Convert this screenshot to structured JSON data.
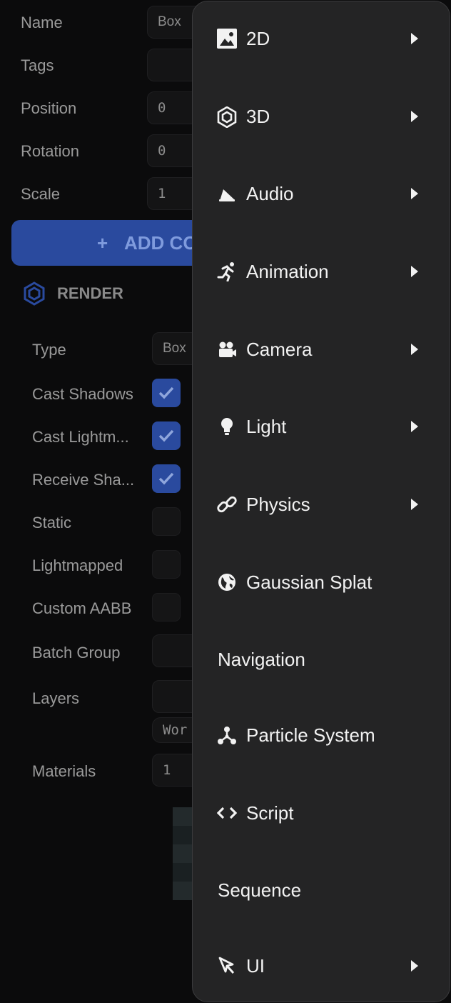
{
  "inspector": {
    "name_label": "Name",
    "name_value": "Box",
    "tags_label": "Tags",
    "position_label": "Position",
    "position_value": "0",
    "rotation_label": "Rotation",
    "rotation_value": "0",
    "scale_label": "Scale",
    "scale_value": "1",
    "add_component_label": "ADD CO",
    "add_component_icon": "plus-icon",
    "render_title": "RENDER",
    "render_icon": "hexagon-icon",
    "type_label": "Type",
    "type_value": "Box",
    "cast_shadows_label": "Cast Shadows",
    "cast_shadows_checked": true,
    "cast_lightmap_label": "Cast Lightm...",
    "cast_lightmap_checked": true,
    "receive_shadows_label": "Receive Sha...",
    "receive_shadows_checked": true,
    "static_label": "Static",
    "static_checked": false,
    "lightmapped_label": "Lightmapped",
    "lightmapped_checked": false,
    "custom_aabb_label": "Custom AABB",
    "custom_aabb_checked": false,
    "batch_group_label": "Batch Group",
    "layers_label": "Layers",
    "layers_tag": "Wor",
    "materials_label": "Materials",
    "materials_value": "1"
  },
  "menu": {
    "items": [
      {
        "label": "2D",
        "icon": "image-icon",
        "submenu": true
      },
      {
        "label": "3D",
        "icon": "hexagon-icon",
        "submenu": true
      },
      {
        "label": "Audio",
        "icon": "speaker-icon",
        "submenu": true
      },
      {
        "label": "Animation",
        "icon": "running-icon",
        "submenu": true
      },
      {
        "label": "Camera",
        "icon": "video-camera-icon",
        "submenu": true
      },
      {
        "label": "Light",
        "icon": "lightbulb-icon",
        "submenu": true
      },
      {
        "label": "Physics",
        "icon": "link-icon",
        "submenu": true
      },
      {
        "label": "Gaussian Splat",
        "icon": "globe-icon",
        "submenu": false
      },
      {
        "label": "Navigation",
        "icon": "",
        "submenu": false
      },
      {
        "label": "Particle System",
        "icon": "particles-icon",
        "submenu": false
      },
      {
        "label": "Script",
        "icon": "code-icon",
        "submenu": false
      },
      {
        "label": "Sequence",
        "icon": "",
        "submenu": false
      },
      {
        "label": "UI",
        "icon": "pointer-icon",
        "submenu": true
      }
    ]
  },
  "colors": {
    "accent": "#2a4a9e",
    "menu_bg": "#242425",
    "panel_bg": "#0b0b0c"
  }
}
